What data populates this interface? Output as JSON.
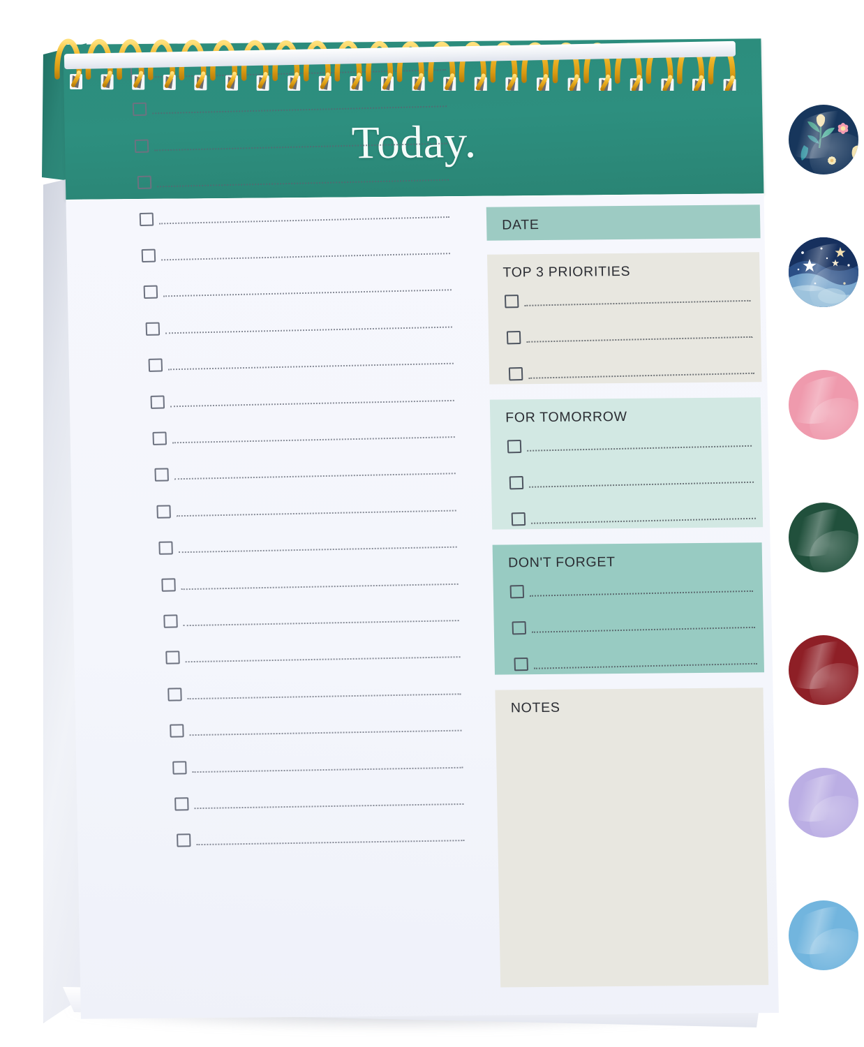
{
  "product": {
    "cover_title": "Today.",
    "cover_color": "#2d8f7f",
    "spiral_color": "#f0b72a",
    "sheet_color": "#f4f6fc"
  },
  "checklist": {
    "name": "daily-task-lines",
    "row_count": 22,
    "checkbox_icon": "empty-checkbox-icon",
    "line_style": "dotted"
  },
  "panels": [
    {
      "id": "date",
      "title": "DATE",
      "bg": "#9dcbc3",
      "rows": 0
    },
    {
      "id": "top-3-priorities",
      "title": "TOP 3 PRIORITIES",
      "bg": "#e8e7e0",
      "rows": 3
    },
    {
      "id": "for-tomorrow",
      "title": "FOR TOMORROW",
      "bg": "#d2e8e3",
      "rows": 3
    },
    {
      "id": "dont-forget",
      "title": "DON'T FORGET",
      "bg": "#98cbc2",
      "rows": 3
    },
    {
      "id": "notes",
      "title": "NOTES",
      "bg": "#e8e7e0",
      "rows": 0
    }
  ],
  "swatches": [
    {
      "id": "navy-floral",
      "name": "navy-floral-swatch",
      "color": "#17365c",
      "kind": "floral"
    },
    {
      "id": "starry-night",
      "name": "starry-night-swatch",
      "color": "#24427a",
      "kind": "stars"
    },
    {
      "id": "pink",
      "name": "pink-swatch",
      "color": "#ef9aad",
      "kind": "solid"
    },
    {
      "id": "dark-green",
      "name": "dark-green-swatch",
      "color": "#21503c",
      "kind": "solid"
    },
    {
      "id": "dark-red",
      "name": "dark-red-swatch",
      "color": "#8e1f26",
      "kind": "solid"
    },
    {
      "id": "lavender",
      "name": "lavender-swatch",
      "color": "#bbaee4",
      "kind": "solid"
    },
    {
      "id": "light-blue",
      "name": "light-blue-swatch",
      "color": "#72b5de",
      "kind": "solid"
    }
  ]
}
